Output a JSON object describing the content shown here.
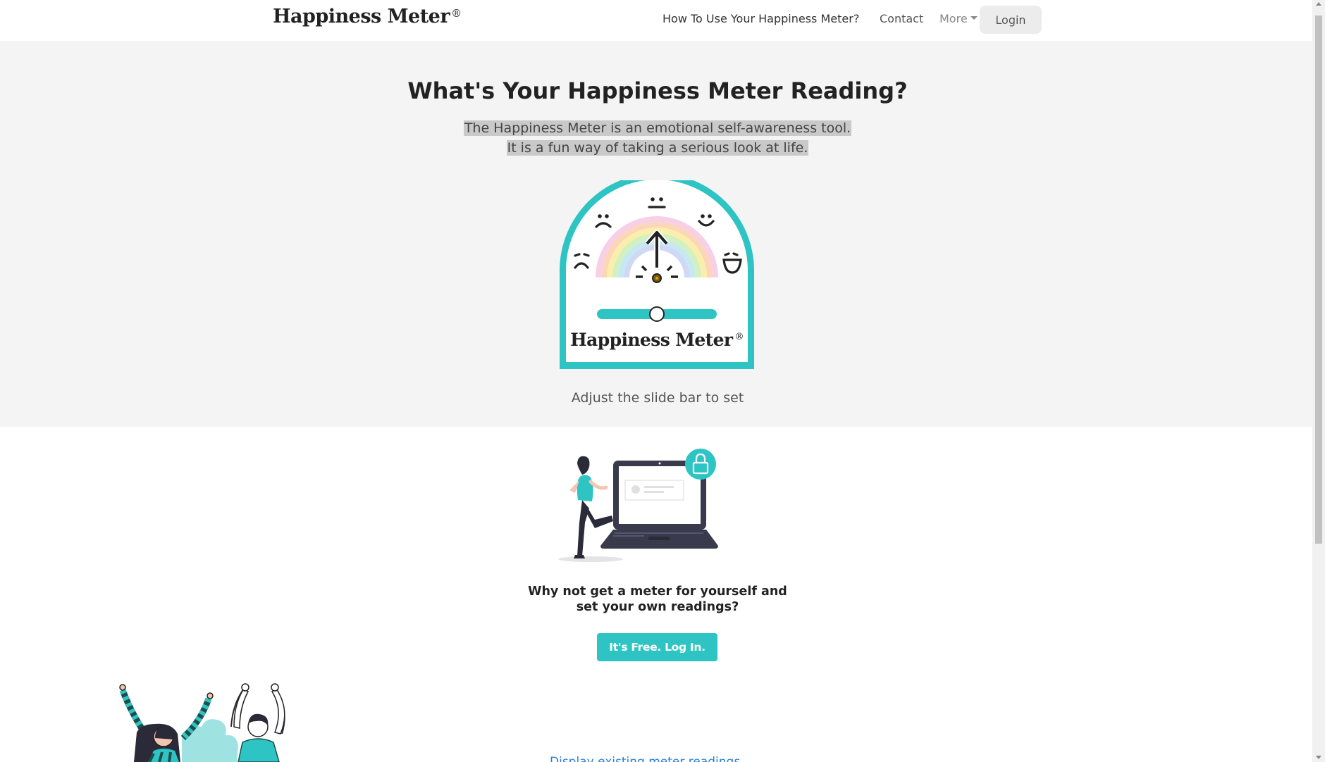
{
  "nav": {
    "brand": "Happiness Meter",
    "brand_mark": "®",
    "how_to": "How To Use Your Happiness Meter?",
    "contact": "Contact",
    "more": "More",
    "login": "Login"
  },
  "hero": {
    "title": "What's Your Happiness Meter Reading?",
    "desc_line1": "The Happiness Meter is an emotional self-awareness tool.",
    "desc_line2": "It is a fun way of taking a serious look at life.",
    "meter_label": "Happiness Meter",
    "meter_mark": "®",
    "slider_value": 0.5,
    "adjust_text": "Adjust the slide bar to set"
  },
  "cta": {
    "text_line1": "Why not get a meter for yourself and",
    "text_line2": "set your own readings?",
    "button": "It's Free. Log In."
  },
  "bottom": {
    "link_text": "Display existing meter readings"
  },
  "colors": {
    "accent": "#2ec4c4",
    "dark": "#3a3a4d"
  },
  "icons": [
    "caret-down-icon",
    "lock-icon",
    "meter-arrow-icon"
  ]
}
